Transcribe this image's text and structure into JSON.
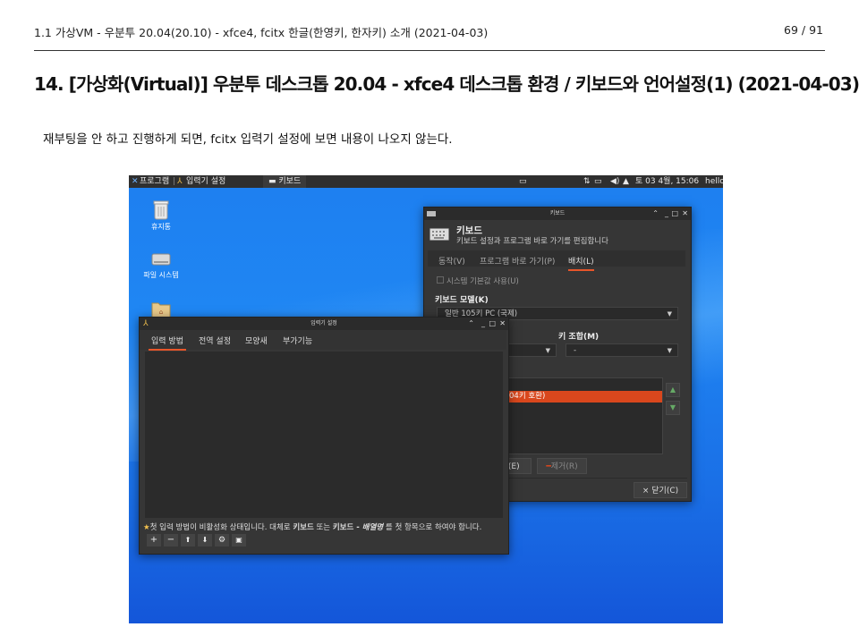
{
  "header": {
    "left": "1.1 가상VM - 우분투 20.04(20.10) - xfce4, fcitx 한글(한영키, 한자키) 소개 (2021-04-03)",
    "page": "69 / 91"
  },
  "title": "14. [가상화(Virtual)] 우분투 데스크톱 20.04 - xfce4 데스크톱 환경 / 키보드와 언어설정(1) (2021-04-03)",
  "paragraph": "재부팅을 안 하고 진행하게 되면, fcitx 입력기 설정에 보면 내용이 나오지 않는다.",
  "screenshot": {
    "panel": {
      "apps_menu": "프로그램",
      "task1": "입력기 설정",
      "task2": "키보드",
      "datetime": "토 03  4월, 15:06",
      "user": "hello"
    },
    "desktop_icons": [
      "휴지통",
      "파일 시스템"
    ],
    "keyboard_window": {
      "title": "키보드",
      "heading": "키보드",
      "subtitle": "키보드 설정과 프로그램 바로 가기를 편집합니다",
      "tabs": [
        "동작(V)",
        "프로그램 바로 가기(P)",
        "배치(L)"
      ],
      "use_system_defaults": "시스템 기본값 사용(U)",
      "model_label": "키보드 모델(K)",
      "model_value": "일반 105키 PC (국제)",
      "key_combo_label": "키 조합(M)",
      "key_combo_value": "-",
      "layout_selected": "04키 호환)",
      "edit_button": "편집(E)",
      "remove_button": "제거(R)",
      "close_button": "닫기(C)"
    },
    "input_window": {
      "title": "입력기 설정",
      "tabs": [
        "입력 방법",
        "전역 설정",
        "모양새",
        "부가기능"
      ],
      "notice_prefix": "첫 입력 방법이 비활성화 상태입니다. 대체로 ",
      "notice_kbd": "키보드",
      "notice_mid": " 또는 ",
      "notice_kbd2": "키보드 - ",
      "notice_layout": "배열명",
      "notice_suffix": " 를 첫 항목으로 하여야 합니다."
    }
  }
}
